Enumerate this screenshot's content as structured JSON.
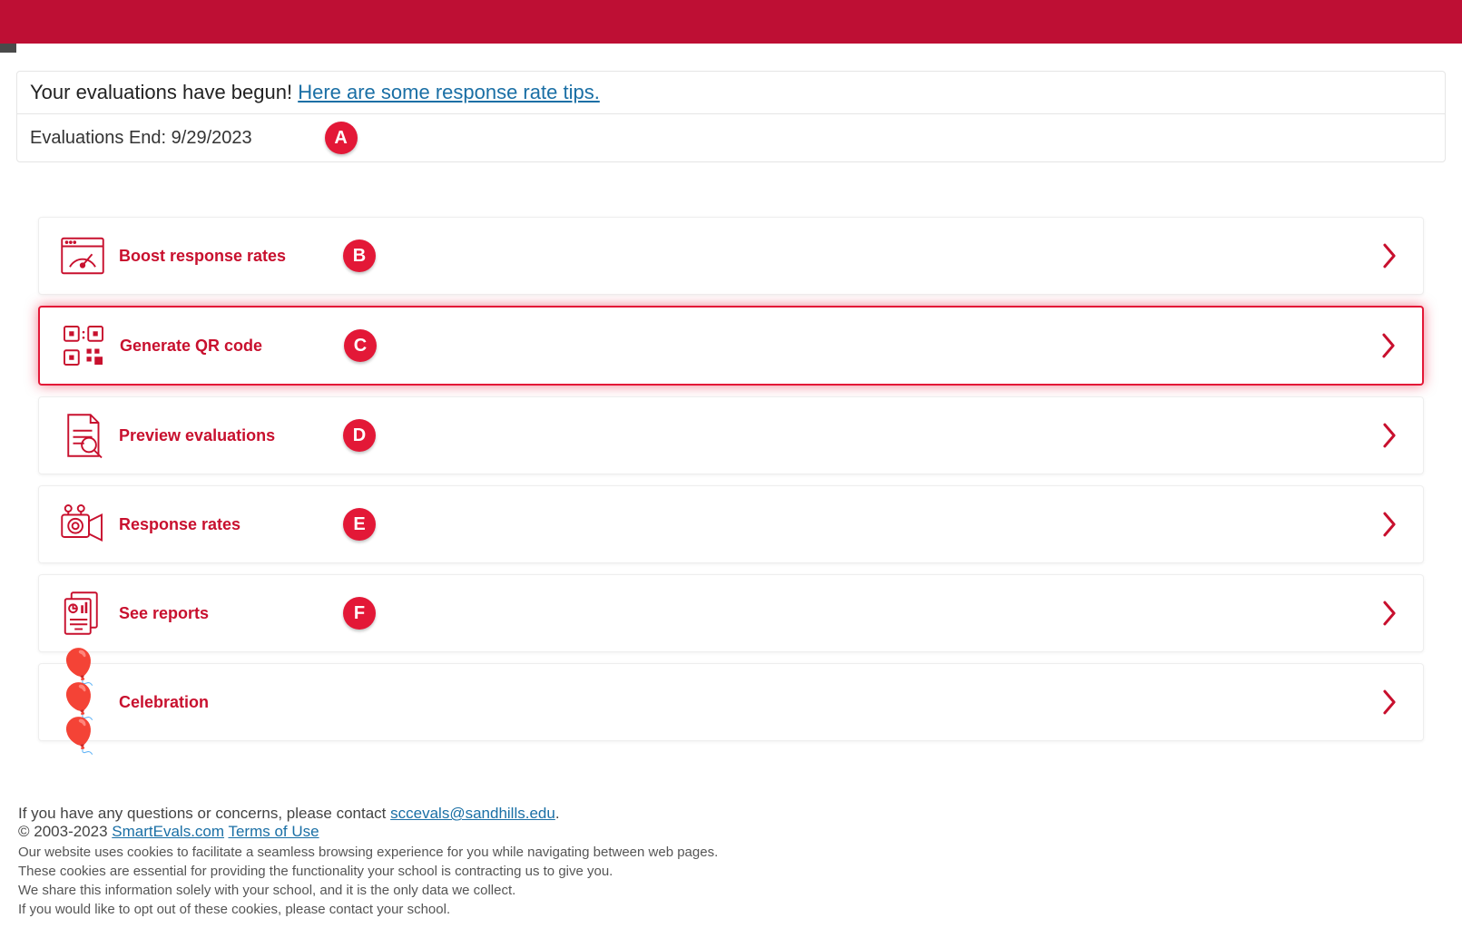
{
  "notice": {
    "prefix_text": "Your evaluations have begun! ",
    "link_text": "Here are some response rate tips.",
    "end_text": "Evaluations End: 9/29/2023",
    "end_badge": "A"
  },
  "menu": [
    {
      "label": "Boost response rates",
      "badge": "B",
      "icon": "gauge",
      "highlight": false
    },
    {
      "label": "Generate QR code",
      "badge": "C",
      "icon": "qr",
      "highlight": true
    },
    {
      "label": "Preview evaluations",
      "badge": "D",
      "icon": "preview",
      "highlight": false
    },
    {
      "label": "Response rates",
      "badge": "E",
      "icon": "camera",
      "highlight": false
    },
    {
      "label": "See reports",
      "badge": "F",
      "icon": "reports",
      "highlight": false
    },
    {
      "label": "Celebration",
      "badge": "",
      "icon": "balloons",
      "highlight": false
    }
  ],
  "footer": {
    "contact_prefix": "If you have any questions or concerns, please contact ",
    "contact_email": "sccevals@sandhills.edu",
    "contact_suffix": ".",
    "copyright_prefix": "© 2003-2023 ",
    "site_link": "SmartEvals.com",
    "terms_link": "Terms of Use",
    "lines": [
      "Our website uses cookies to facilitate a seamless browsing experience for you while navigating between web pages.",
      "These cookies are essential for providing the functionality your school is contracting us to give you.",
      "We share this information solely with your school, and it is the only data we collect.",
      "If you would like to opt out of these cookies, please contact your school."
    ]
  }
}
